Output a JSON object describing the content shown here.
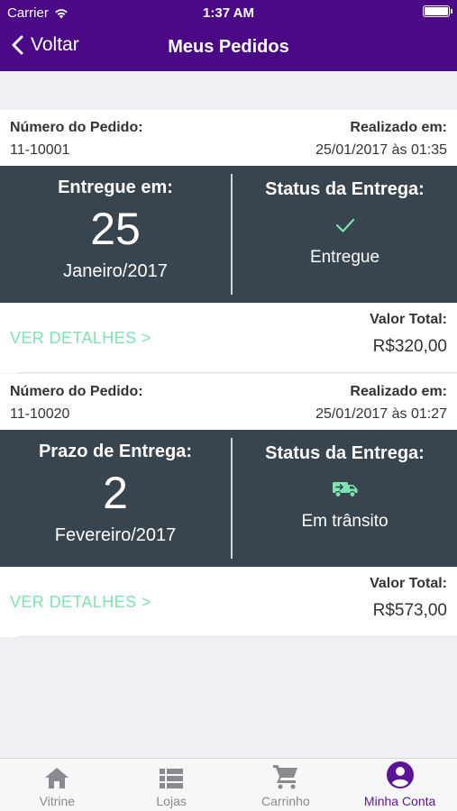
{
  "status_bar": {
    "carrier": "Carrier",
    "time": "1:37 AM"
  },
  "nav": {
    "back_label": "Voltar",
    "title": "Meus Pedidos"
  },
  "colors": {
    "brand": "#4a0a86",
    "panel": "#38444e",
    "accent_green": "#7ee3b1",
    "active_tab": "#5b1497"
  },
  "orders": [
    {
      "number_label": "Número do Pedido:",
      "number": "11-10001",
      "placed_label": "Realizado em:",
      "placed_at": "25/01/2017 às 01:35",
      "date_label": "Entregue em:",
      "day": "25",
      "month": "Janeiro/2017",
      "status_label": "Status da Entrega:",
      "status_icon": "check-icon",
      "status": "Entregue",
      "details_label": "VER DETALHES >",
      "total_label": "Valor Total:",
      "total": "R$320,00"
    },
    {
      "number_label": "Número do Pedido:",
      "number": "11-10020",
      "placed_label": "Realizado em:",
      "placed_at": "25/01/2017 às 01:27",
      "date_label": "Prazo de Entrega:",
      "day": "2",
      "month": "Fevereiro/2017",
      "status_label": "Status da Entrega:",
      "status_icon": "truck-icon",
      "status": "Em trânsito",
      "details_label": "VER DETALHES >",
      "total_label": "Valor Total:",
      "total": "R$573,00"
    }
  ],
  "tabs": [
    {
      "label": "Vitrine",
      "icon": "home-icon",
      "active": false
    },
    {
      "label": "Lojas",
      "icon": "list-icon",
      "active": false
    },
    {
      "label": "Carrinho",
      "icon": "cart-icon",
      "active": false
    },
    {
      "label": "Minha Conta",
      "icon": "account-icon",
      "active": true
    }
  ]
}
